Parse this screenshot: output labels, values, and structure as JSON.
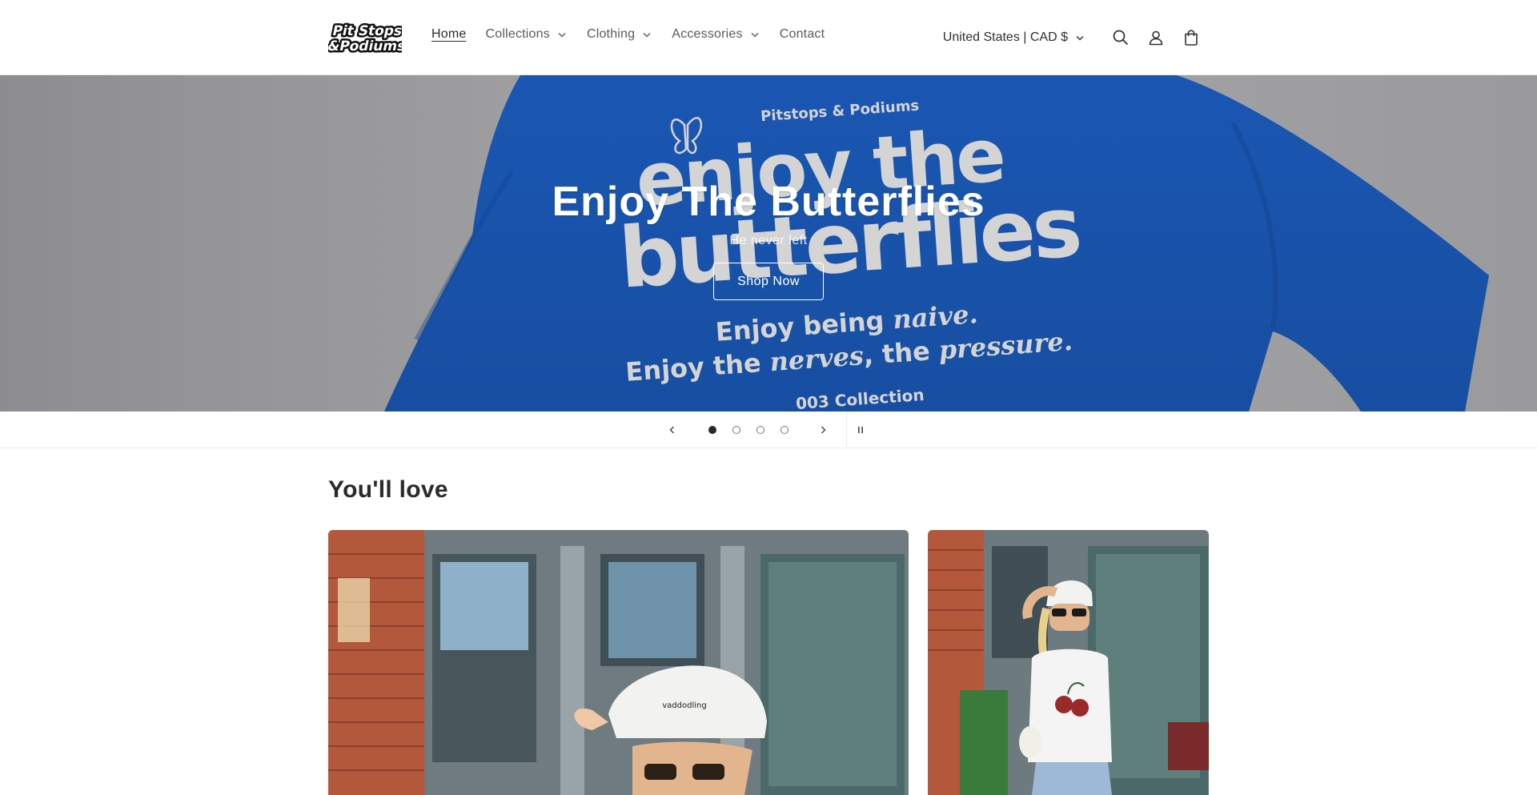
{
  "header": {
    "logo_text": "Pit Stops & Podiums",
    "nav": [
      {
        "label": "Home",
        "active": true,
        "dropdown": false
      },
      {
        "label": "Collections",
        "active": false,
        "dropdown": true
      },
      {
        "label": "Clothing",
        "active": false,
        "dropdown": true
      },
      {
        "label": "Accessories",
        "active": false,
        "dropdown": true
      },
      {
        "label": "Contact",
        "active": false,
        "dropdown": false
      }
    ],
    "country_selector": "United States | CAD $",
    "icons": [
      "search-icon",
      "account-icon",
      "cart-icon"
    ]
  },
  "hero": {
    "title": "Enjoy The Butterflies",
    "subtitle": "He never left",
    "button_label": "Shop Now",
    "garment_print": {
      "brand": "Pitstops & Podiums",
      "line1": "enjoy the",
      "line2": "butterflies",
      "line3": "Enjoy being naive.",
      "line4": "Enjoy the nerves, the pressure.",
      "line5": "003 Collection"
    },
    "colors": {
      "garment": "#1f63c4",
      "background": "#a9a9ac"
    }
  },
  "slideshow": {
    "slides": 4,
    "current": 1,
    "icons": [
      "chevron-left-icon",
      "chevron-right-icon",
      "pause-icon"
    ]
  },
  "featured": {
    "heading": "You'll love",
    "cards": [
      {
        "hat_text": "vaddodling"
      },
      {
        "hat_text": ""
      }
    ]
  }
}
